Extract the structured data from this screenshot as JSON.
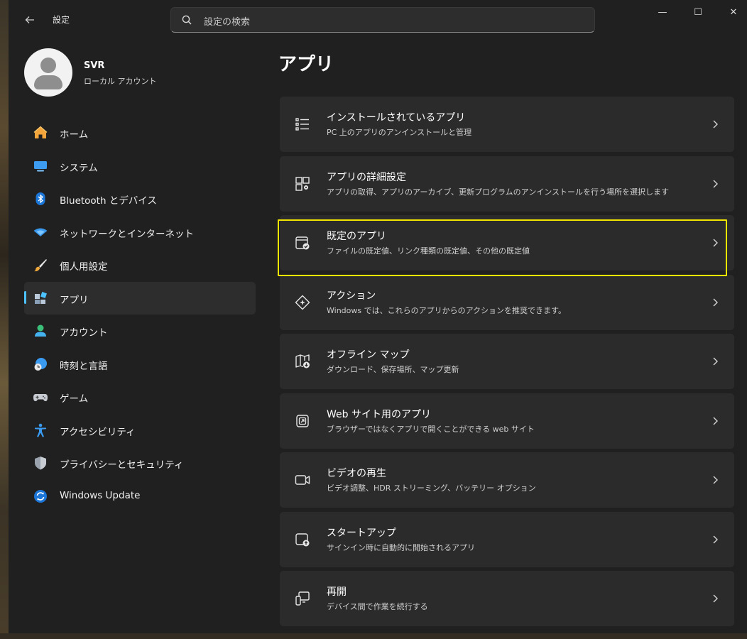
{
  "window": {
    "title": "設定"
  },
  "search": {
    "placeholder": "設定の検索"
  },
  "window_controls": {
    "minimize": "—",
    "maximize": "☐",
    "close": "✕"
  },
  "user": {
    "name": "SVR",
    "account_type": "ローカル アカウント"
  },
  "sidebar": {
    "items": [
      {
        "label": "ホーム",
        "icon": "home-icon"
      },
      {
        "label": "システム",
        "icon": "system-icon"
      },
      {
        "label": "Bluetooth とデバイス",
        "icon": "bluetooth-icon"
      },
      {
        "label": "ネットワークとインターネット",
        "icon": "wifi-icon"
      },
      {
        "label": "個人用設定",
        "icon": "brush-icon"
      },
      {
        "label": "アプリ",
        "icon": "apps-icon",
        "selected": true
      },
      {
        "label": "アカウント",
        "icon": "account-icon"
      },
      {
        "label": "時刻と言語",
        "icon": "clock-globe-icon"
      },
      {
        "label": "ゲーム",
        "icon": "gamepad-icon"
      },
      {
        "label": "アクセシビリティ",
        "icon": "accessibility-icon"
      },
      {
        "label": "プライバシーとセキュリティ",
        "icon": "shield-icon"
      },
      {
        "label": "Windows Update",
        "icon": "update-icon"
      }
    ]
  },
  "main": {
    "title": "アプリ",
    "cards": [
      {
        "title": "インストールされているアプリ",
        "desc": "PC 上のアプリのアンインストールと管理",
        "icon": "installed-apps-icon"
      },
      {
        "title": "アプリの詳細設定",
        "desc": "アプリの取得、アプリのアーカイブ、更新プログラムのアンインストールを行う場所を選択します",
        "icon": "advanced-apps-icon"
      },
      {
        "title": "既定のアプリ",
        "desc": "ファイルの既定値、リンク種類の既定値、その他の既定値",
        "icon": "default-apps-icon",
        "highlighted": true
      },
      {
        "title": "アクション",
        "desc": "Windows では、これらのアプリからのアクションを推奨できます。",
        "icon": "actions-icon"
      },
      {
        "title": "オフライン マップ",
        "desc": "ダウンロード、保存場所、マップ更新",
        "icon": "offline-map-icon"
      },
      {
        "title": "Web サイト用のアプリ",
        "desc": "ブラウザーではなくアプリで開くことができる web サイト",
        "icon": "web-apps-icon"
      },
      {
        "title": "ビデオの再生",
        "desc": "ビデオ調整、HDR ストリーミング、バッテリー オプション",
        "icon": "video-icon"
      },
      {
        "title": "スタートアップ",
        "desc": "サインイン時に自動的に開始されるアプリ",
        "icon": "startup-icon"
      },
      {
        "title": "再開",
        "desc": "デバイス間で作業を続行する",
        "icon": "resume-icon"
      }
    ]
  },
  "colors": {
    "window_bg": "#202020",
    "card_bg": "#2b2b2b",
    "accent": "#4cc2ff",
    "highlight": "#f2e600"
  }
}
